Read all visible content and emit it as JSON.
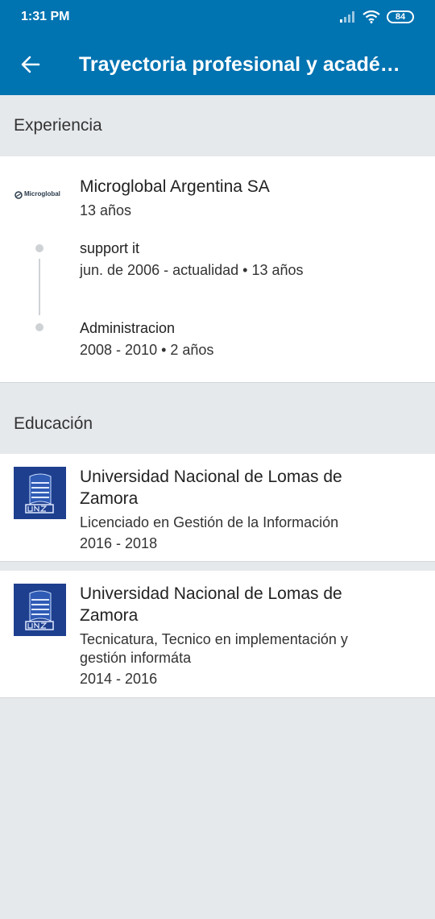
{
  "status_bar": {
    "time": "1:31 PM",
    "battery": "84"
  },
  "app_bar": {
    "title": "Trayectoria profesional y acadé…"
  },
  "experience": {
    "section_title": "Experiencia",
    "company": "Microglobal Argentina SA",
    "company_logo_text": "Microglobal",
    "duration": "13 años",
    "roles": [
      {
        "title": "support it",
        "dates": "jun. de 2006 - actualidad • 13 años"
      },
      {
        "title": "Administracion",
        "dates": "2008 - 2010 • 2 años"
      }
    ]
  },
  "education": {
    "section_title": "Educación",
    "items": [
      {
        "school_line1": "Universidad Nacional de Lomas de",
        "school_line2": "Zamora",
        "degree_line1": "Licenciado en Gestión de la Información",
        "degree_line2": "",
        "dates": "2016 - 2018"
      },
      {
        "school_line1": "Universidad Nacional de Lomas de",
        "school_line2": "Zamora",
        "degree_line1": "Tecnicatura, Tecnico en implementación y",
        "degree_line2": "gestión informáta",
        "dates": "2014 - 2016"
      }
    ]
  },
  "colors": {
    "brand": "#0073b1",
    "background": "#e6e9ec",
    "logo_blue": "#1e3f8e"
  },
  "icons": [
    "back-arrow-icon",
    "signal-icon",
    "wifi-icon",
    "battery-icon"
  ]
}
